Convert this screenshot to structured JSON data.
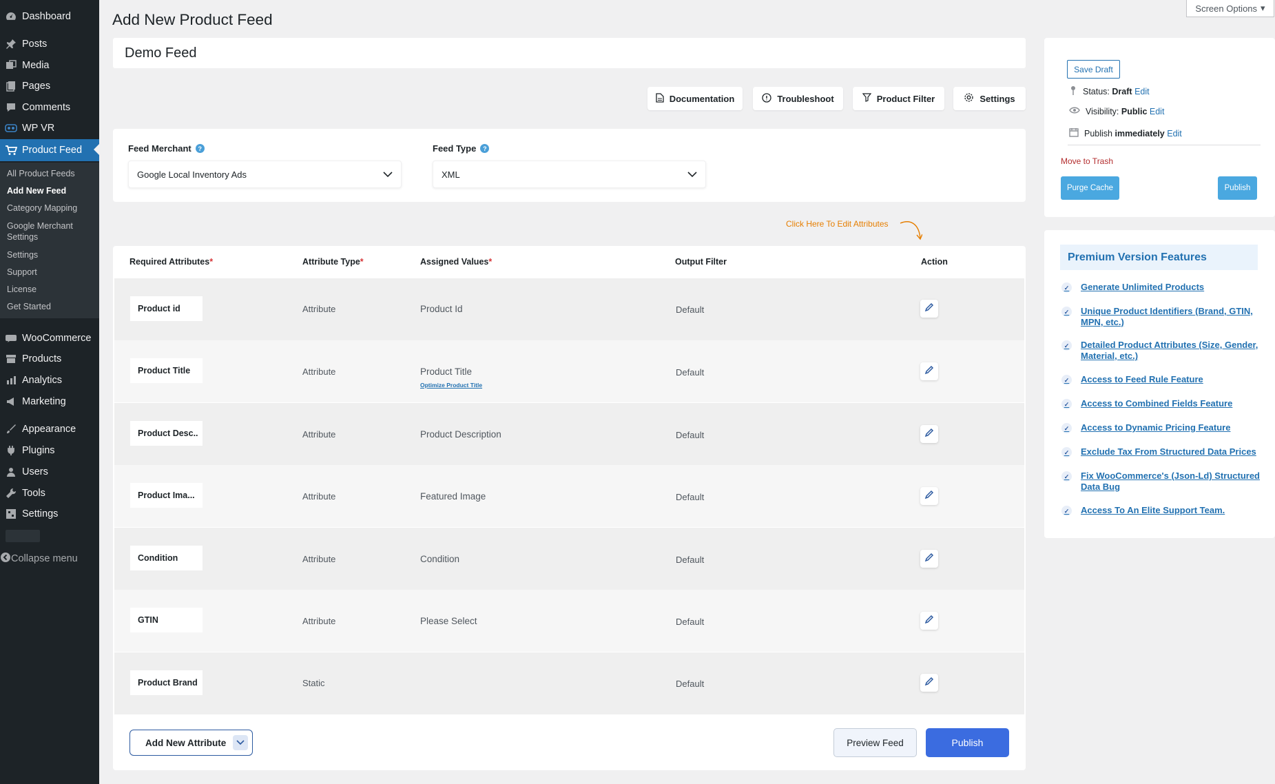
{
  "sidebar": {
    "items": [
      {
        "label": "Dashboard",
        "icon": "dashboard-icon"
      },
      {
        "label": "Posts",
        "icon": "pin-icon"
      },
      {
        "label": "Media",
        "icon": "media-icon"
      },
      {
        "label": "Pages",
        "icon": "pages-icon"
      },
      {
        "label": "Comments",
        "icon": "comments-icon"
      },
      {
        "label": "WP VR",
        "icon": "vr-icon"
      },
      {
        "label": "Product Feed",
        "icon": "cart-icon"
      },
      {
        "label": "WooCommerce",
        "icon": "woo-icon"
      },
      {
        "label": "Products",
        "icon": "archive-icon"
      },
      {
        "label": "Analytics",
        "icon": "chart-bar-icon"
      },
      {
        "label": "Marketing",
        "icon": "megaphone-icon"
      },
      {
        "label": "Appearance",
        "icon": "brush-icon"
      },
      {
        "label": "Plugins",
        "icon": "plug-icon"
      },
      {
        "label": "Users",
        "icon": "user-icon"
      },
      {
        "label": "Tools",
        "icon": "wrench-icon"
      },
      {
        "label": "Settings",
        "icon": "settings-icon"
      }
    ],
    "submenu": [
      "All Product Feeds",
      "Add New Feed",
      "Category Mapping",
      "Google Merchant",
      "Settings",
      "Settings",
      "Support",
      "License",
      "Get Started"
    ],
    "collapse_label": "Collapse menu"
  },
  "screen_options": "Screen Options",
  "page_title": "Add New Product Feed",
  "feed_name": "Demo Feed",
  "toolbar": {
    "documentation": "Documentation",
    "troubleshoot": "Troubleshoot",
    "product_filter": "Product Filter",
    "settings": "Settings"
  },
  "merchant": {
    "label": "Feed Merchant",
    "value": "Google Local Inventory Ads"
  },
  "feed_type": {
    "label": "Feed Type",
    "value": "XML"
  },
  "hint": "Click Here To Edit Attributes",
  "table": {
    "headers": {
      "required": "Required Attributes",
      "type": "Attribute Type",
      "values": "Assigned Values",
      "filter": "Output Filter",
      "action": "Action",
      "asterisk": "*"
    },
    "rows": [
      {
        "attr": "Product id",
        "type": "Attribute",
        "value": "Product Id",
        "filter": "Default"
      },
      {
        "attr": "Product Title",
        "type": "Attribute",
        "value": "Product Title",
        "filter": "Default",
        "link": "Optimize Product Title"
      },
      {
        "attr": "Product Desc...",
        "type": "Attribute",
        "value": "Product Description",
        "filter": "Default"
      },
      {
        "attr": "Product Ima...",
        "type": "Attribute",
        "value": "Featured Image",
        "filter": "Default"
      },
      {
        "attr": "Condition",
        "type": "Attribute",
        "value": "Condition",
        "filter": "Default"
      },
      {
        "attr": "GTIN",
        "type": "Attribute",
        "value": "Please Select",
        "filter": "Default"
      },
      {
        "attr": "Product Brand",
        "type": "Static",
        "value": "",
        "filter": "Default"
      }
    ]
  },
  "footer": {
    "add_attribute": "Add New Attribute",
    "preview": "Preview Feed",
    "publish": "Publish"
  },
  "publish_box": {
    "save_draft": "Save Draft",
    "status_label": "Status:",
    "status_value": "Draft",
    "visibility_label": "Visibility:",
    "visibility_value": "Public",
    "publish_label": "Publish",
    "publish_value": "immediately",
    "edit": "Edit",
    "trash": "Move to Trash",
    "purge": "Purge Cache",
    "publish": "Publish"
  },
  "premium": {
    "title": "Premium Version Features",
    "features": [
      "Generate Unlimited Products",
      "Unique Product Identifiers (Brand, GTIN, MPN, etc.)",
      "Detailed Product Attributes (Size, Gender, Material, etc.)",
      "Access to Feed Rule Feature",
      "Access to Combined Fields Feature",
      "Access to Dynamic Pricing Feature",
      "Exclude Tax From Structured Data Prices",
      "Fix WooCommerce's (Json-Ld) Structured Data Bug",
      "Access To An Elite Support Team."
    ]
  },
  "colors": {
    "sidebar": "#1d2327",
    "accent": "#2271b1",
    "publish": "#3b6ce0",
    "hint": "#e67e00"
  }
}
